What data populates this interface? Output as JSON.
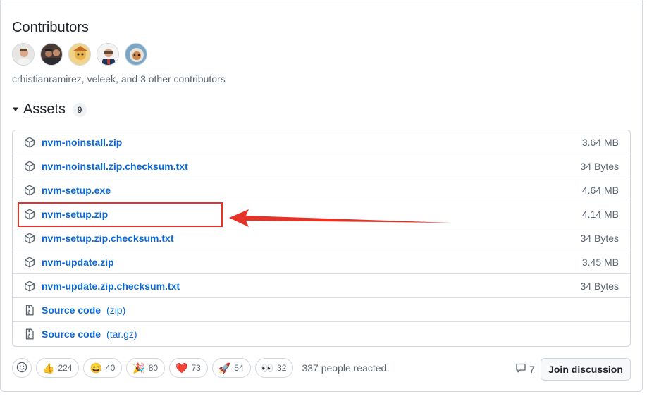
{
  "contributors": {
    "title": "Contributors",
    "avatars": [
      "avatar-1",
      "avatar-2",
      "avatar-3",
      "avatar-4",
      "avatar-5"
    ],
    "summary": "crhistianramirez, veleek, and 3 other contributors"
  },
  "assets": {
    "title": "Assets",
    "count": "9",
    "items": [
      {
        "name": "nvm-noinstall.zip",
        "size": "3.64 MB",
        "icon": "package-icon"
      },
      {
        "name": "nvm-noinstall.zip.checksum.txt",
        "size": "34 Bytes",
        "icon": "package-icon"
      },
      {
        "name": "nvm-setup.exe",
        "size": "4.64 MB",
        "icon": "package-icon"
      },
      {
        "name": "nvm-setup.zip",
        "size": "4.14 MB",
        "icon": "package-icon"
      },
      {
        "name": "nvm-setup.zip.checksum.txt",
        "size": "34 Bytes",
        "icon": "package-icon"
      },
      {
        "name": "nvm-update.zip",
        "size": "3.45 MB",
        "icon": "package-icon"
      },
      {
        "name": "nvm-update.zip.checksum.txt",
        "size": "34 Bytes",
        "icon": "package-icon"
      },
      {
        "name": "Source code",
        "suffix": "(zip)",
        "icon": "file-zip-icon"
      },
      {
        "name": "Source code",
        "suffix": "(tar.gz)",
        "icon": "file-zip-icon"
      }
    ]
  },
  "reactions": {
    "items": [
      {
        "emoji": "👍",
        "count": "224",
        "icon": "thumbs-up-icon"
      },
      {
        "emoji": "😄",
        "count": "40",
        "icon": "laugh-icon"
      },
      {
        "emoji": "🎉",
        "count": "80",
        "icon": "hooray-icon"
      },
      {
        "emoji": "❤️",
        "count": "73",
        "icon": "heart-icon"
      },
      {
        "emoji": "🚀",
        "count": "54",
        "icon": "rocket-icon"
      },
      {
        "emoji": "👀",
        "count": "32",
        "icon": "eyes-icon"
      }
    ],
    "summary": "337 people reacted"
  },
  "discussion": {
    "comment_count": "7",
    "join_label": "Join discussion"
  },
  "colors": {
    "link": "#0969da",
    "highlight": "#e5332a"
  }
}
